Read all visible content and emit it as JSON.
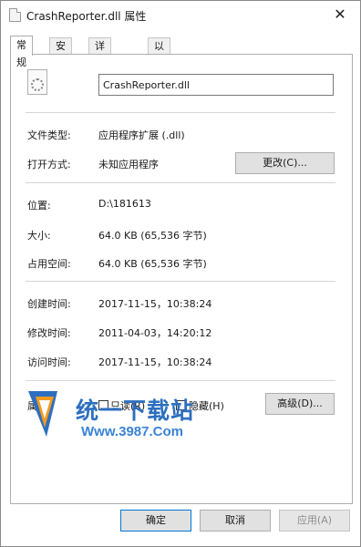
{
  "window": {
    "title": "CrashReporter.dll 属性",
    "close_glyph": "✕"
  },
  "tabs": [
    {
      "label": "常规",
      "active": true
    },
    {
      "label": "安全",
      "active": false
    },
    {
      "label": "详细信息",
      "active": false
    },
    {
      "label": "以前的版本",
      "active": false
    }
  ],
  "file": {
    "name": "CrashReporter.dll",
    "icon": "dll-file-icon"
  },
  "fields": {
    "type_label": "文件类型:",
    "type_value": "应用程序扩展 (.dll)",
    "open_label": "打开方式:",
    "open_value": "未知应用程序",
    "change_button": "更改(C)...",
    "location_label": "位置:",
    "location_value": "D:\\181613",
    "size_label": "大小:",
    "size_value": "64.0 KB (65,536 字节)",
    "disk_label": "占用空间:",
    "disk_value": "64.0 KB (65,536 字节)",
    "created_label": "创建时间:",
    "created_value": "2017-11-15，10:38:24",
    "modified_label": "修改时间:",
    "modified_value": "2011-04-03，14:20:12",
    "accessed_label": "访问时间:",
    "accessed_value": "2017-11-15，10:38:24",
    "attr_label": "属性:",
    "readonly_label": "只读(R)",
    "hidden_label": "隐藏(H)",
    "advanced_button": "高级(D)..."
  },
  "watermark": {
    "title": "统一下载站",
    "url": "Www.3987.Com"
  },
  "footer": {
    "ok": "确定",
    "cancel": "取消",
    "apply": "应用(A)"
  },
  "colors": {
    "accent": "#0078d7",
    "watermark": "#2d6fbf"
  }
}
